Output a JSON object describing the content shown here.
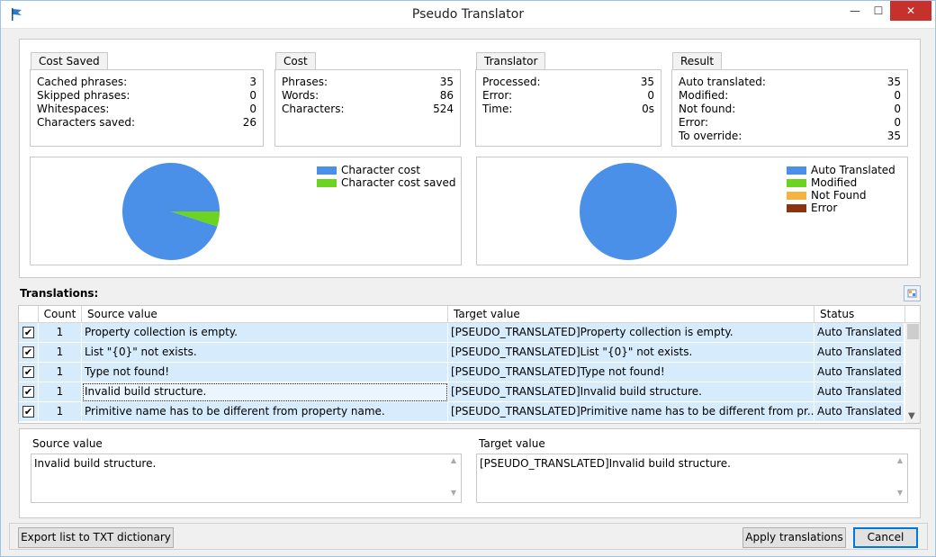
{
  "window": {
    "title": "Pseudo Translator",
    "min_glyph": "—",
    "max_glyph": "☐",
    "close_glyph": "✕",
    "icon": "flag-icon"
  },
  "stats": {
    "cost_saved": {
      "title": "Cost Saved",
      "rows": [
        {
          "label": "Cached phrases:",
          "value": "3"
        },
        {
          "label": "Skipped phrases:",
          "value": "0"
        },
        {
          "label": "Whitespaces:",
          "value": "0"
        },
        {
          "label": "Characters saved:",
          "value": "26"
        }
      ]
    },
    "cost": {
      "title": "Cost",
      "rows": [
        {
          "label": "Phrases:",
          "value": "35"
        },
        {
          "label": "Words:",
          "value": "86"
        },
        {
          "label": "Characters:",
          "value": "524"
        }
      ]
    },
    "translator": {
      "title": "Translator",
      "rows": [
        {
          "label": "Processed:",
          "value": "35"
        },
        {
          "label": "Error:",
          "value": "0"
        },
        {
          "label": "Time:",
          "value": "0s"
        }
      ]
    },
    "result": {
      "title": "Result",
      "rows": [
        {
          "label": "Auto translated:",
          "value": "35"
        },
        {
          "label": "Modified:",
          "value": "0"
        },
        {
          "label": "Not found:",
          "value": "0"
        },
        {
          "label": "Error:",
          "value": "0"
        },
        {
          "label": "To override:",
          "value": "35"
        }
      ]
    }
  },
  "chart_data": [
    {
      "type": "pie",
      "categories": [
        "Character cost",
        "Character cost saved"
      ],
      "values": [
        498,
        26
      ],
      "colors": [
        "#4a90e8",
        "#6ad41e"
      ],
      "legend": "top-right"
    },
    {
      "type": "pie",
      "categories": [
        "Auto Translated",
        "Modified",
        "Not Found",
        "Error"
      ],
      "values": [
        35,
        0,
        0,
        0
      ],
      "colors": [
        "#4a90e8",
        "#6ad41e",
        "#f5b342",
        "#8b3510"
      ],
      "legend": "top-right"
    }
  ],
  "translations": {
    "label": "Translations:",
    "columns": [
      "Count",
      "Source value",
      "Target value",
      "Status"
    ],
    "rows": [
      {
        "checked": "✔",
        "count": "1",
        "source": "Property collection is empty.",
        "target": "[PSEUDO_TRANSLATED]Property collection is empty.",
        "status": "Auto Translated"
      },
      {
        "checked": "✔",
        "count": "1",
        "source": "List \"{0}\" not exists.",
        "target": "[PSEUDO_TRANSLATED]List \"{0}\" not exists.",
        "status": "Auto Translated"
      },
      {
        "checked": "✔",
        "count": "1",
        "source": "Type not found!",
        "target": "[PSEUDO_TRANSLATED]Type not found!",
        "status": "Auto Translated"
      },
      {
        "checked": "✔",
        "count": "1",
        "source": "Invalid build structure.",
        "target": "[PSEUDO_TRANSLATED]Invalid build structure.",
        "status": "Auto Translated"
      },
      {
        "checked": "✔",
        "count": "1",
        "source": "Primitive name has to be different from property name.",
        "target": "[PSEUDO_TRANSLATED]Primitive name has to be different from pr...",
        "status": "Auto Translated"
      }
    ]
  },
  "detail": {
    "source_label": "Source value",
    "source_value": "Invalid build structure.",
    "target_label": "Target value",
    "target_value": "[PSEUDO_TRANSLATED]Invalid build structure."
  },
  "buttons": {
    "export": "Export list to TXT dictionary",
    "apply": "Apply translations",
    "cancel": "Cancel"
  }
}
